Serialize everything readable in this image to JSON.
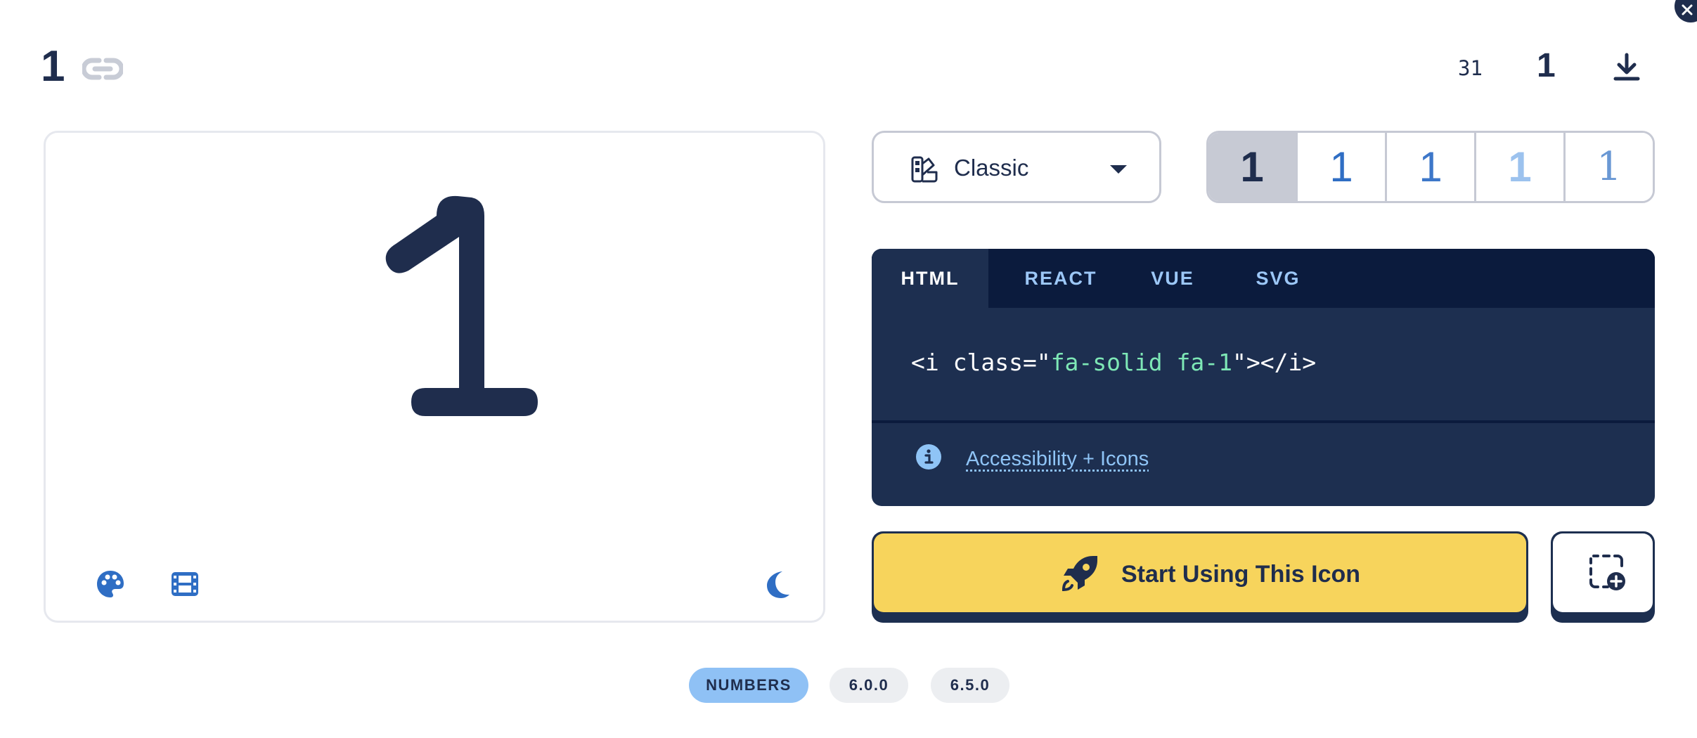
{
  "header": {
    "icon_name": "1",
    "count": "31",
    "unicode_glyph": "1"
  },
  "preview": {
    "glyph": "1",
    "glyph_color": "#1f2d4d",
    "tools": [
      "palette-icon",
      "film-icon",
      "moon-icon"
    ],
    "tool_color": "#2f6ec4"
  },
  "style_select": {
    "selected": "Classic"
  },
  "family_options": [
    "1",
    "1",
    "1",
    "1",
    "1"
  ],
  "code": {
    "tabs": [
      "HTML",
      "REACT",
      "VUE",
      "SVG"
    ],
    "active_tab": "HTML",
    "snippet_prefix": "<i class=\"",
    "snippet_class": "fa-solid fa-1",
    "snippet_suffix": "\"></i>",
    "accessibility_link": "Accessibility + Icons"
  },
  "cta": {
    "label": "Start Using This Icon",
    "color": "#f7d45c"
  },
  "tags": [
    "NUMBERS",
    "6.0.0",
    "6.5.0"
  ]
}
